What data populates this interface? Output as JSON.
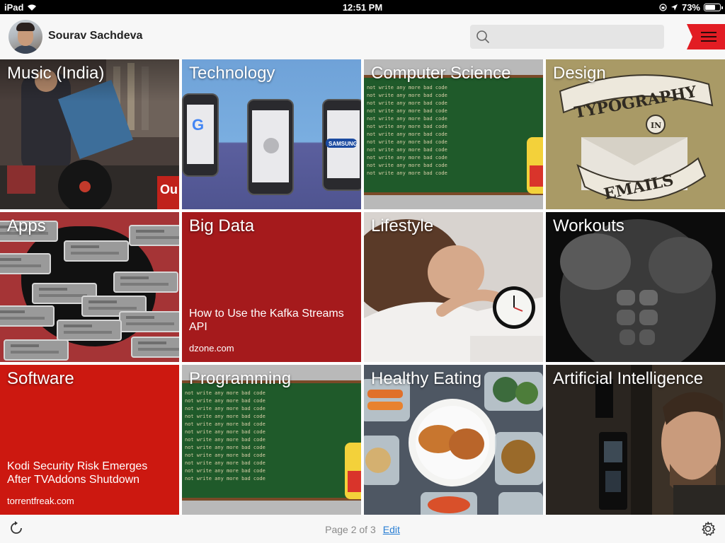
{
  "status": {
    "device": "iPad",
    "time": "12:51 PM",
    "battery": "73%",
    "battery_level": 0.73
  },
  "header": {
    "username": "Sourav Sachdeva",
    "search_placeholder": ""
  },
  "tiles": [
    {
      "title": "Music (India)"
    },
    {
      "title": "Technology"
    },
    {
      "title": "Computer Science"
    },
    {
      "title": "Design"
    },
    {
      "title": "Apps"
    },
    {
      "title": "Big Data",
      "story": "How to Use the Kafka Streams API",
      "source": "dzone.com"
    },
    {
      "title": "Lifestyle"
    },
    {
      "title": "Workouts"
    },
    {
      "title": "Software",
      "story": "Kodi Security Risk Emerges After TVAddons Shutdown",
      "source": "torrentfreak.com"
    },
    {
      "title": "Programming"
    },
    {
      "title": "Healthy Eating"
    },
    {
      "title": "Artificial Intelligence"
    }
  ],
  "art": {
    "chalk_text": "not write any more bad code",
    "phone_brands": [
      "G",
      "",
      "SAMSUNG"
    ],
    "design_banner_top": "TYPOGRAPHY",
    "design_banner_mid": "IN",
    "design_banner_bottom": "EMAILS",
    "music_sign": "Ou"
  },
  "footer": {
    "page_label": "Page 2 of 3",
    "edit_label": "Edit"
  },
  "colors": {
    "accent_red": "#e21c23",
    "tile_red_dark": "#a51a1c",
    "tile_red": "#cc1810",
    "link_blue": "#2a7fd4"
  }
}
